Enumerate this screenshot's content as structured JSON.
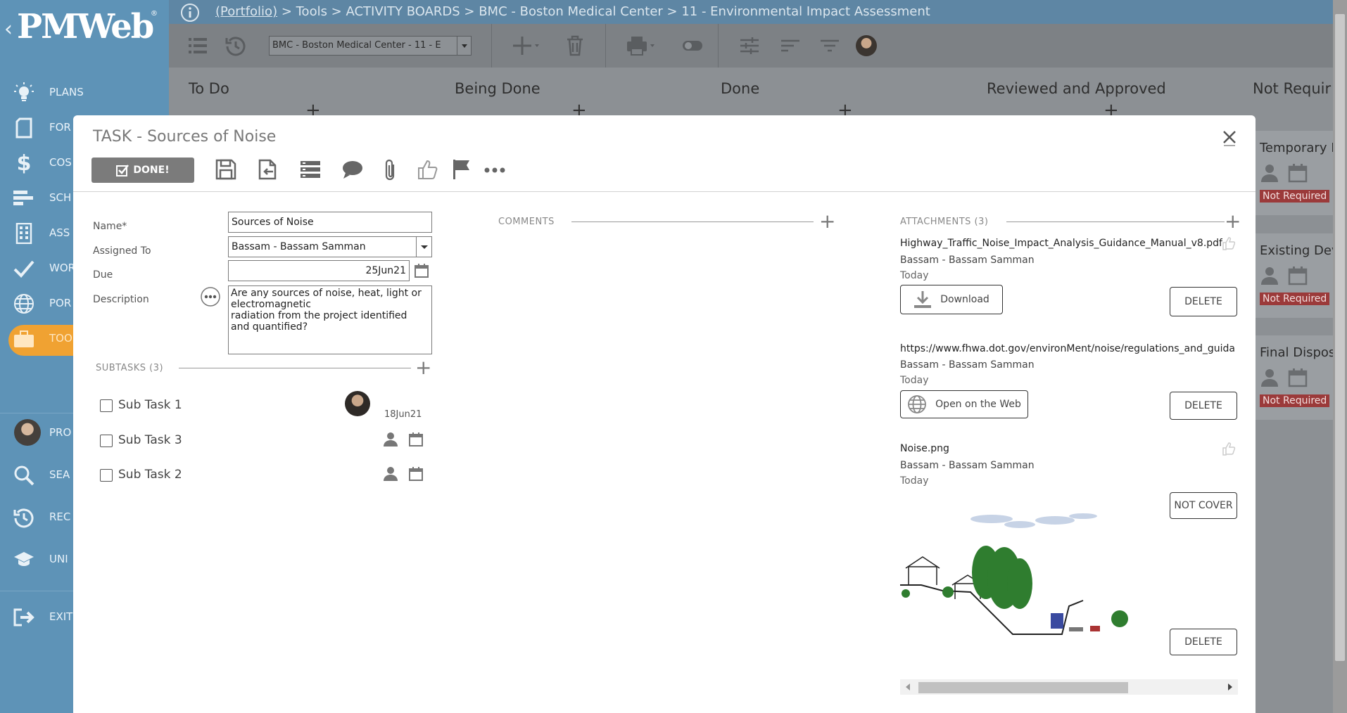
{
  "app": {
    "logo": "PMWeb",
    "logo_chevron": "‹",
    "logo_reg": "®"
  },
  "breadcrumb": {
    "portfolio": "(Portfolio)",
    "rest": " > Tools > ACTIVITY BOARDS > BMC - Boston Medical Center > 11 - Environmental Impact Assessment"
  },
  "sidebar": {
    "items": [
      {
        "label": "PLANS",
        "icon": "lightbulb-icon"
      },
      {
        "label": "FOR",
        "icon": "document-icon"
      },
      {
        "label": "COS",
        "icon": "dollar-icon"
      },
      {
        "label": "SCH",
        "icon": "gantt-icon"
      },
      {
        "label": "ASS",
        "icon": "building-icon"
      },
      {
        "label": "WOR",
        "icon": "checkmark-icon"
      },
      {
        "label": "POR",
        "icon": "globe-icon"
      },
      {
        "label": "TOO",
        "icon": "briefcase-icon"
      },
      {
        "label": "PRO",
        "icon": "avatar"
      },
      {
        "label": "SEA",
        "icon": "search-icon"
      },
      {
        "label": "REC",
        "icon": "history-icon"
      },
      {
        "label": "UNI",
        "icon": "graduation-cap-icon"
      },
      {
        "label": "EXIT",
        "icon": "exit-icon"
      }
    ]
  },
  "toolbar": {
    "project_select": "BMC - Boston Medical Center - 11 - E"
  },
  "board": {
    "columns": [
      "To Do",
      "Being Done",
      "Done",
      "Reviewed and Approved",
      "Not Requir"
    ],
    "right_cards": [
      {
        "title": "Temporary L",
        "badge": "Not Required"
      },
      {
        "title": "Existing Dev",
        "badge": "Not Required"
      },
      {
        "title": "Final Dispos",
        "badge": "Not Required"
      }
    ]
  },
  "modal": {
    "title": "TASK - Sources of Noise",
    "done_label": "DONE!",
    "fields": {
      "name_label": "Name*",
      "name_value": "Sources of Noise",
      "assigned_label": "Assigned To",
      "assigned_value": "Bassam - Bassam Samman",
      "due_label": "Due",
      "due_value": "25Jun21",
      "description_label": "Description",
      "description_value": "Are any sources of noise, heat, light or\nelectromagnetic\nradiation from the project identified\nand quantified?"
    },
    "subtasks": {
      "header": "SUBTASKS (3)",
      "items": [
        {
          "label": "Sub Task 1",
          "date": "18Jun21"
        },
        {
          "label": "Sub Task 3"
        },
        {
          "label": "Sub Task 2"
        }
      ]
    },
    "comments": {
      "header": "COMMENTS"
    },
    "attachments": {
      "header": "ATTACHMENTS (3)",
      "items": [
        {
          "name": "Highway_Traffic_Noise_Impact_Analysis_Guidance_Manual_v8.pdf",
          "user": "Bassam - Bassam Samman",
          "date": "Today",
          "action": "Download",
          "side_button": "DELETE"
        },
        {
          "name": "https://www.fhwa.dot.gov/environMent/noise/regulations_and_guida",
          "user": "Bassam - Bassam Samman",
          "date": "Today",
          "action": "Open on the Web",
          "side_button": "DELETE"
        },
        {
          "name": "Noise.png",
          "user": "Bassam - Bassam Samman",
          "date": "Today",
          "top_button": "NOT COVER",
          "side_button": "DELETE"
        }
      ]
    }
  }
}
